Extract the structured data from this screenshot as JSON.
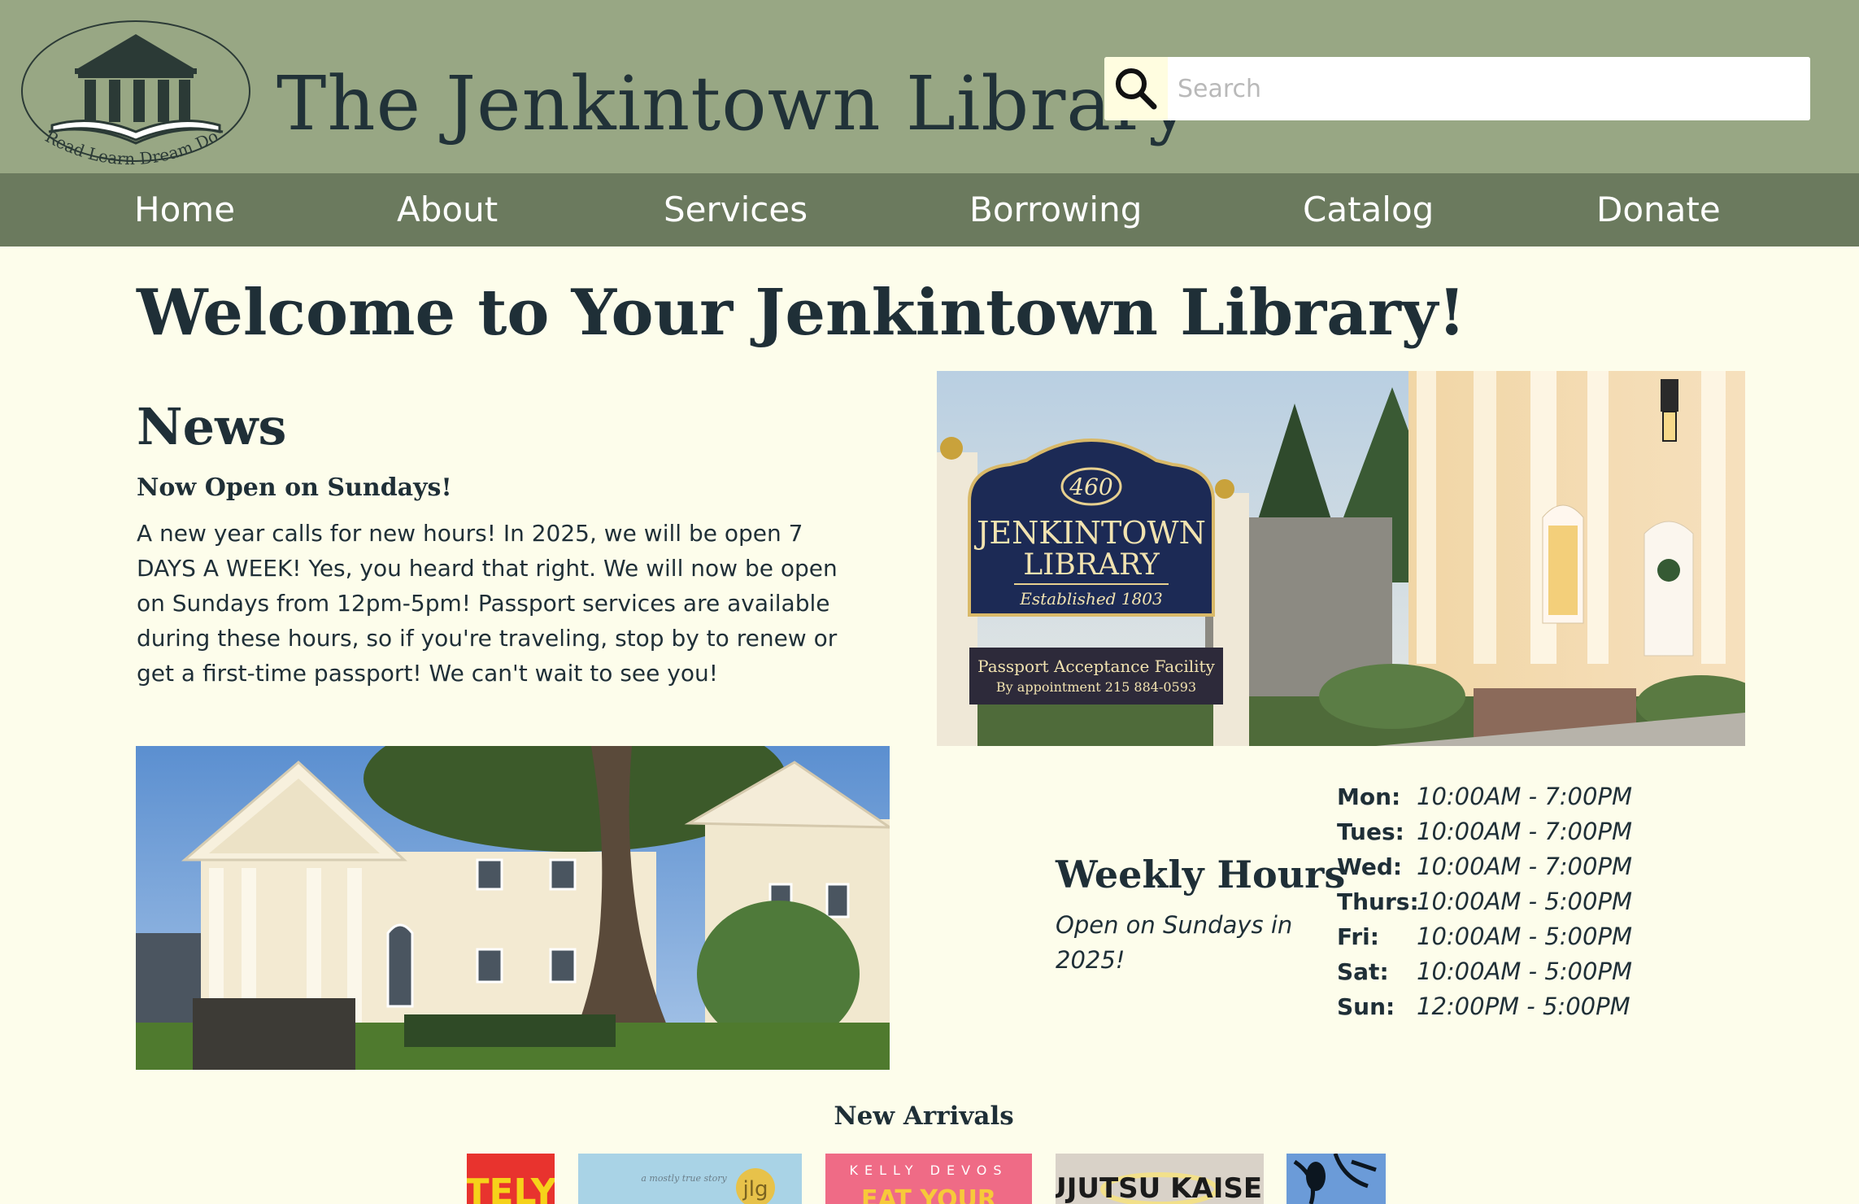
{
  "header": {
    "logo_text": "Read Learn Dream Do",
    "site_title": "The Jenkintown Library",
    "search_placeholder": "Search"
  },
  "nav": {
    "items": [
      "Home",
      "About",
      "Services",
      "Borrowing",
      "Catalog",
      "Donate"
    ]
  },
  "main": {
    "title": "Welcome to Your Jenkintown Library!",
    "news": {
      "heading": "News",
      "subheading": "Now Open on Sundays!",
      "body": "A new year calls for new hours! In 2025, we will be open 7 DAYS A WEEK! Yes, you heard that right. We will now be open on Sundays from 12pm-5pm! Passport services are available during these hours, so if you're traveling, stop by to renew or get a first-time passport! We can't wait to see you!"
    },
    "sign_photo": {
      "number": "460",
      "name_line1": "JENKINTOWN",
      "name_line2": "LIBRARY",
      "established": "Established 1803",
      "passport_line1": "Passport Acceptance Facility",
      "passport_line2": "By appointment 215 884-0593"
    },
    "hours": {
      "heading": "Weekly Hours",
      "note": "Open on Sundays in 2025!",
      "rows": [
        {
          "day": "Mon:",
          "time": "10:00AM - 7:00PM"
        },
        {
          "day": "Tues:",
          "time": "10:00AM - 7:00PM"
        },
        {
          "day": "Wed:",
          "time": "10:00AM - 7:00PM"
        },
        {
          "day": "Thurs:",
          "time": "10:00AM - 5:00PM"
        },
        {
          "day": "Fri:",
          "time": "10:00AM - 5:00PM"
        },
        {
          "day": "Sat:",
          "time": "10:00AM - 5:00PM"
        },
        {
          "day": "Sun:",
          "time": "12:00PM - 5:00PM"
        }
      ]
    },
    "new_arrivals": {
      "heading": "New Arrivals",
      "books": [
        {
          "cover_text": "TELY",
          "color": "#e8332e"
        },
        {
          "cover_text": "a mostly true story",
          "badge": "jlg",
          "color": "#a9d3e6"
        },
        {
          "cover_text": "KELLY DEVOS",
          "cover_text2": "EAT YOUR",
          "color": "#ef6b86"
        },
        {
          "cover_text": "JUJUTSU KAISEN",
          "color": "#d9d2c8"
        },
        {
          "cover_text": "",
          "color": "#6b9bd8"
        }
      ]
    }
  }
}
